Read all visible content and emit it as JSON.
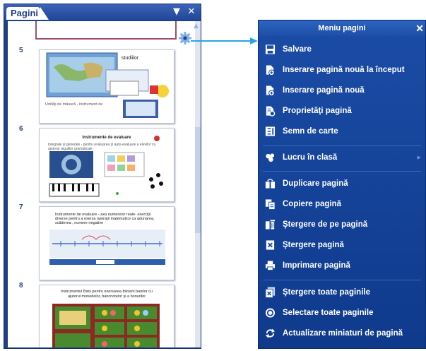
{
  "pages_panel": {
    "tab_title": "Pagini",
    "dropdown_glyph": "▼",
    "close_glyph": "✕",
    "pages": [
      {
        "number": "5",
        "title": "studiilor",
        "caption": "Unităţi de măsură - instrument de"
      },
      {
        "number": "6",
        "title": "Instrumente de evaluare",
        "caption": "Integrale şi generale - pentru evaluarea şi auto-evaluare a elevilor cu ajutorul regulilor gramaticale"
      },
      {
        "number": "7",
        "title": "Instrumente de evaluare - axa numerelor reale- exerciţii diverse pentru a exersa operaţii matematice ca adunarea, scăderea , numere negative",
        "caption": ""
      },
      {
        "number": "8",
        "title": "Instrumentul Bani pentru exersarea folosirii banilor cu ajutorul monedelor, bancnotelor şi a bonurilor",
        "caption": ""
      }
    ]
  },
  "menu": {
    "title": "Meniu pagini",
    "close_glyph": "✕",
    "items": [
      {
        "label": "Salvare",
        "icon": "save-icon"
      },
      {
        "label": "Inserare pagină nouă la început",
        "icon": "insert-page-start-icon"
      },
      {
        "label": "Inserare pagină nouă",
        "icon": "insert-page-icon"
      },
      {
        "label": "Proprietăţi pagină",
        "icon": "page-properties-icon"
      },
      {
        "label": "Semn de carte",
        "icon": "bookmark-icon"
      },
      {
        "label": "Lucru în clasă",
        "icon": "classroom-icon",
        "submenu_glyph": "▶"
      },
      {
        "label": "Duplicare pagină",
        "icon": "duplicate-page-icon"
      },
      {
        "label": "Copiere pagină",
        "icon": "copy-page-icon"
      },
      {
        "label": "Ştergere de pe pagină",
        "icon": "clear-page-icon"
      },
      {
        "label": "Ştergere pagină",
        "icon": "delete-page-icon"
      },
      {
        "label": "Imprimare pagină",
        "icon": "print-page-icon"
      },
      {
        "label": "Ştergere toate paginile",
        "icon": "delete-all-pages-icon"
      },
      {
        "label": "Selectare toate paginile",
        "icon": "select-all-pages-icon"
      },
      {
        "label": "Actualizare miniaturi de pagină",
        "icon": "refresh-thumbnails-icon"
      }
    ]
  },
  "colors": {
    "panel_blue": "#1f3f86",
    "menu_blue": "#1b4ca6",
    "arrow_blue": "#29a3e8",
    "selected_page_border": "#a0506a"
  }
}
